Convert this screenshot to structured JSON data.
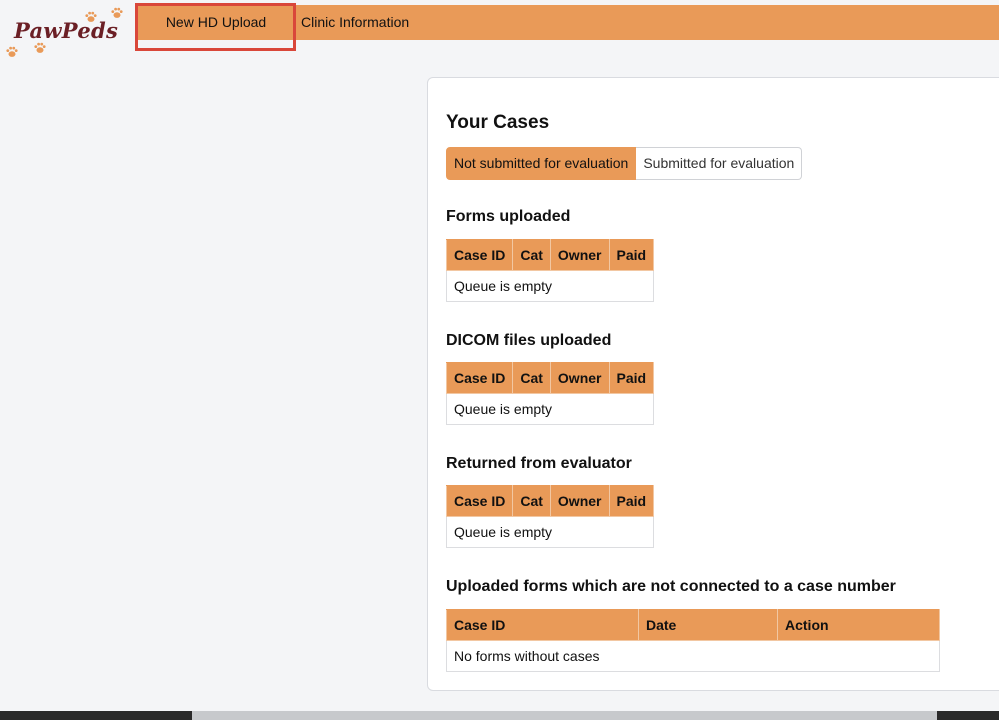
{
  "logo": {
    "text": "PawPeds"
  },
  "nav": {
    "items": [
      {
        "label": "New HD Upload"
      },
      {
        "label": "Clinic Information"
      }
    ]
  },
  "colors": {
    "accent": "#e99a58",
    "highlight": "#d9473a",
    "brand": "#6b1f25"
  },
  "cases": {
    "title": "Your Cases",
    "tabs": [
      {
        "label": "Not submitted for evaluation",
        "active": true
      },
      {
        "label": "Submitted for evaluation",
        "active": false
      }
    ],
    "sections": [
      {
        "title": "Forms uploaded",
        "columns": [
          "Case ID",
          "Cat",
          "Owner",
          "Paid"
        ],
        "empty_text": "Queue is empty"
      },
      {
        "title": "DICOM files uploaded",
        "columns": [
          "Case ID",
          "Cat",
          "Owner",
          "Paid"
        ],
        "empty_text": "Queue is empty"
      },
      {
        "title": "Returned from evaluator",
        "columns": [
          "Case ID",
          "Cat",
          "Owner",
          "Paid"
        ],
        "empty_text": "Queue is empty"
      },
      {
        "title": "Uploaded forms which are not connected to a case number",
        "columns": [
          "Case ID",
          "Date",
          "Action"
        ],
        "empty_text": "No forms without cases"
      }
    ]
  }
}
